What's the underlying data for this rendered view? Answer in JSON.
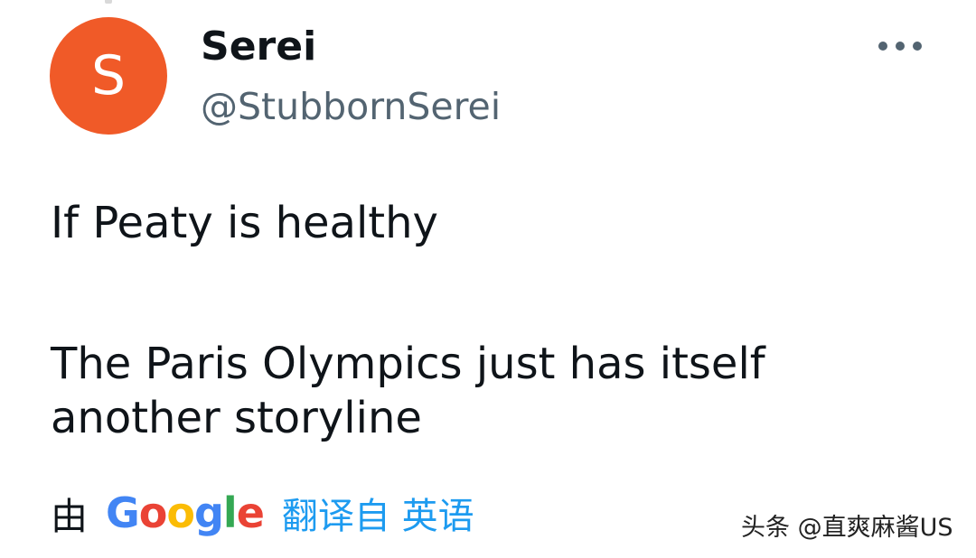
{
  "tweet": {
    "avatar_letter": "S",
    "display_name": "Serei",
    "handle": "@StubbornSerei",
    "lines": [
      "If Peaty is healthy",
      "The Paris Olympics just has itself",
      "another storyline"
    ],
    "more_icon": "more-horizontal-icon"
  },
  "translation": {
    "by": "由",
    "google": [
      "G",
      "o",
      "o",
      "g",
      "l",
      "e"
    ],
    "from": "翻译自 英语"
  },
  "watermark": "头条 @直爽麻酱US",
  "colors": {
    "avatar_bg": "#f05a28",
    "secondary_text": "#536471",
    "translate_link": "#1d9bf0",
    "google_blue": "#4285f4",
    "google_red": "#ea4335",
    "google_yellow": "#fbbc05",
    "google_green": "#34a853"
  }
}
